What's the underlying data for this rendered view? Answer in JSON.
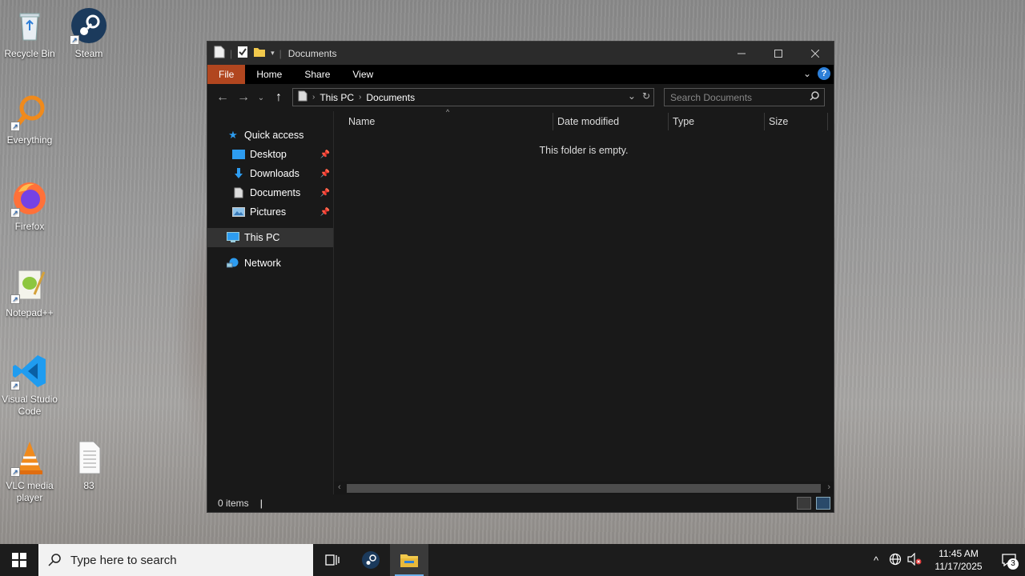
{
  "desktop": {
    "icons": [
      {
        "label": "Recycle Bin",
        "icon": "recycle-bin-icon"
      },
      {
        "label": "Steam",
        "icon": "steam-icon"
      },
      {
        "label": "Everything",
        "icon": "everything-search-icon"
      },
      {
        "label": "Firefox",
        "icon": "firefox-icon"
      },
      {
        "label": "Notepad++",
        "icon": "notepad-plus-plus-icon"
      },
      {
        "label": "Visual Studio Code",
        "icon": "vscode-icon"
      },
      {
        "label": "VLC media player",
        "icon": "vlc-icon"
      },
      {
        "label": "83",
        "icon": "text-file-icon"
      }
    ]
  },
  "explorer": {
    "title": "Documents",
    "ribbon": {
      "tabs": [
        "File",
        "Home",
        "Share",
        "View"
      ]
    },
    "breadcrumb": [
      "This PC",
      "Documents"
    ],
    "search": {
      "placeholder": "Search Documents"
    },
    "nav_pane": {
      "quick_access": "Quick access",
      "pinned": [
        "Desktop",
        "Downloads",
        "Documents",
        "Pictures"
      ],
      "this_pc": "This PC",
      "network": "Network"
    },
    "columns": [
      "Name",
      "Date modified",
      "Type",
      "Size"
    ],
    "empty_message": "This folder is empty.",
    "status": {
      "item_count": "0 items"
    }
  },
  "taskbar": {
    "search_placeholder": "Type here to search",
    "clock": {
      "time": "11:45 AM",
      "date": "11/17/2025"
    },
    "notification_count": "3"
  },
  "colors": {
    "file_tab": "#b1461f",
    "window_bg": "#191919",
    "accent_blue": "#2d7fd8"
  }
}
